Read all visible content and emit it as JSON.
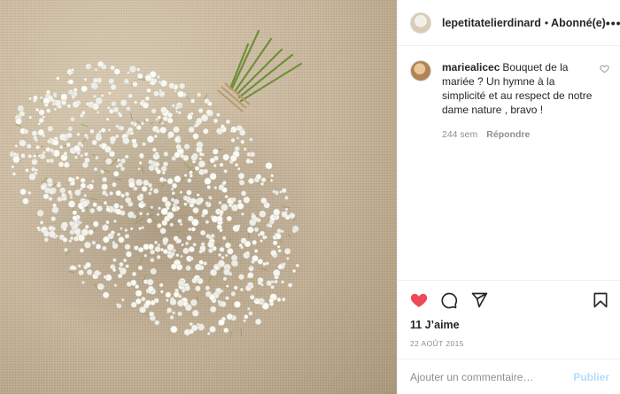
{
  "post": {
    "image_alt": "Bouquet de gypsophile posé sur une toile de jute",
    "image_icon": "gypsophila-bouquet"
  },
  "header": {
    "username": "lepetitatelierdinard",
    "separator": "•",
    "follow_label": "Abonné(e)",
    "more_icon": "more-options-icon",
    "more_glyph": "•••"
  },
  "comments": [
    {
      "username": "mariealicec",
      "text": "Bouquet de la mariée ? Un hymne à la simplicité et au respect de notre dame nature , bravo !",
      "time": "244 sem",
      "reply_label": "Répondre",
      "like_icon": "heart-outline-icon"
    }
  ],
  "actions": {
    "like_icon": "heart-filled-icon",
    "comment_icon": "comment-icon",
    "share_icon": "paper-plane-icon",
    "save_icon": "bookmark-icon",
    "liked": true
  },
  "likes": {
    "label": "11 J’aime"
  },
  "date": {
    "label": "22 AOÛT 2015"
  },
  "add_comment": {
    "placeholder": "Ajouter un commentaire…",
    "value": "",
    "publish_label": "Publier"
  },
  "colors": {
    "like_red": "#ed4956",
    "text": "#262626",
    "muted": "#8e8e8e",
    "publish_disabled": "#b2dffc",
    "divider": "#efefef"
  }
}
